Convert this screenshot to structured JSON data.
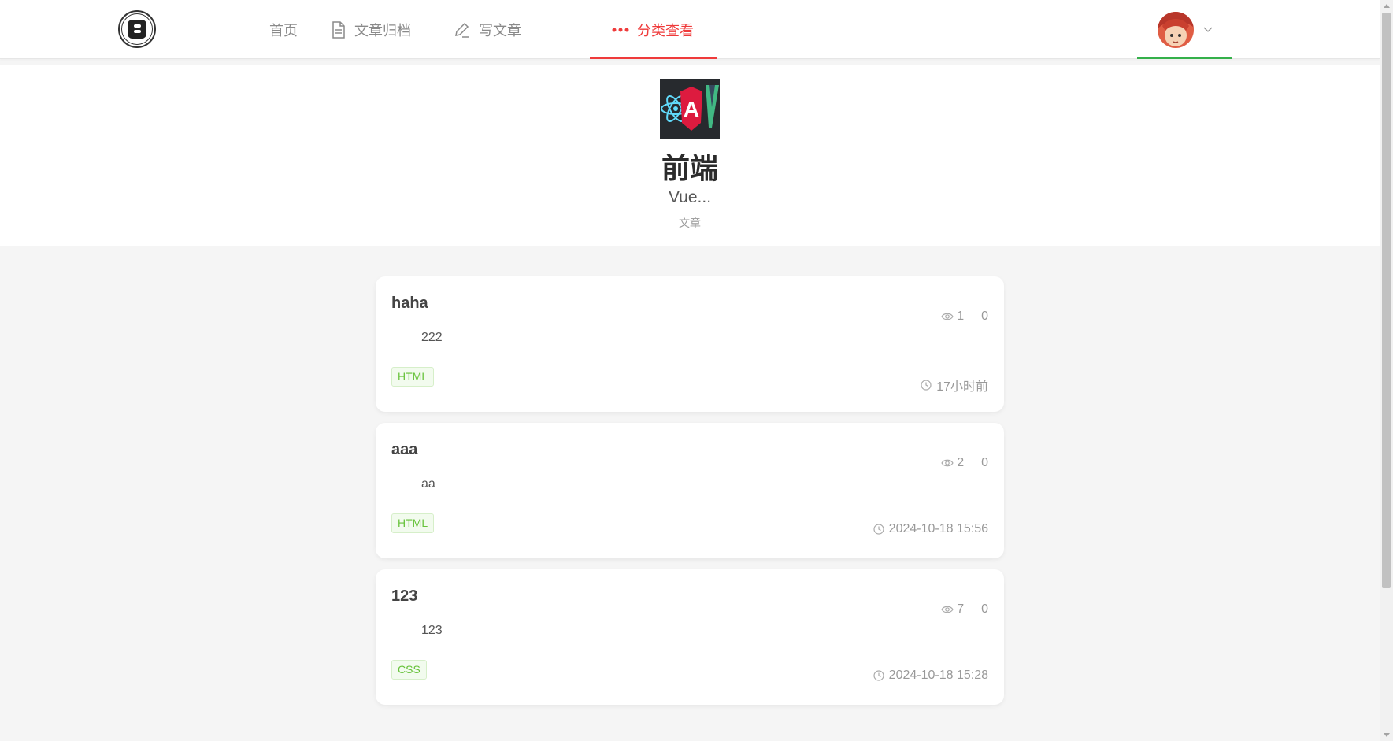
{
  "header": {
    "logo_letter": "B",
    "nav": [
      {
        "label": "首页",
        "icon": "none",
        "active": false
      },
      {
        "label": "文章归档",
        "icon": "document-icon",
        "active": false
      },
      {
        "label": "写文章",
        "icon": "pencil-icon",
        "active": false
      },
      {
        "label": "分类查看",
        "icon": "ellipsis-icon",
        "active": true
      }
    ],
    "user": {
      "avatar": "avatar",
      "dropdown_icon": "chevron-down-icon"
    }
  },
  "category": {
    "image_letters": "AV",
    "title": "前端",
    "description": "Vue...",
    "subtitle": "文章"
  },
  "articles": [
    {
      "title": "haha",
      "summary": "222",
      "views": "1",
      "comments": "0",
      "tag": "HTML",
      "time": "17小时前"
    },
    {
      "title": "aaa",
      "summary": "aa",
      "views": "2",
      "comments": "0",
      "tag": "HTML",
      "time": "2024-10-18 15:56"
    },
    {
      "title": "123",
      "summary": "123",
      "views": "7",
      "comments": "0",
      "tag": "CSS",
      "time": "2024-10-18 15:28"
    }
  ],
  "colors": {
    "accent": "#ef3b3b",
    "user_underline": "#35b04a",
    "tag_text": "#67c23a",
    "background": "#f5f5f5"
  }
}
